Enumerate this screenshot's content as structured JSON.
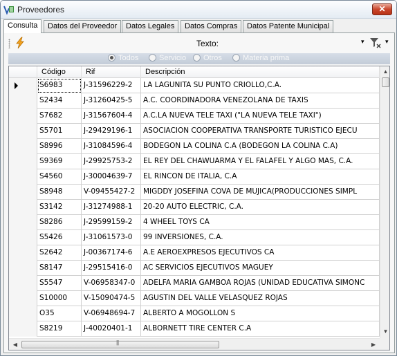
{
  "window": {
    "title": "Proveedores",
    "close_label": "✕"
  },
  "tabs": [
    {
      "label": "Consulta"
    },
    {
      "label": "Datos del Proveedor"
    },
    {
      "label": "Datos Legales"
    },
    {
      "label": "Datos Compras"
    },
    {
      "label": "Datos Patente Municipal"
    }
  ],
  "toolbar": {
    "texto_label": "Texto:",
    "dropdown_glyph": "▾",
    "filter_dropdown_glyph": "▾"
  },
  "filter_options": [
    {
      "label": "Todos",
      "checked": true
    },
    {
      "label": "Servicio",
      "checked": false
    },
    {
      "label": "Otros",
      "checked": false
    },
    {
      "label": "Materia prima",
      "checked": false
    }
  ],
  "grid": {
    "columns": [
      "Código",
      "Rif",
      "Descripción"
    ],
    "rows": [
      [
        "S6983",
        "J-31596229-2",
        " LA LAGUNITA SU PUNTO CRIOLLO,C.A."
      ],
      [
        "S2434",
        "J-31260425-5",
        " A.C. COORDINADORA VENEZOLANA DE TAXIS"
      ],
      [
        "S7682",
        "J-31567604-4",
        " A.C.LA NUEVA TELE TAXI (\"LA NUEVA TELE TAXI\")"
      ],
      [
        "S5701",
        "J-29429196-1",
        " ASOCIACION COOPERATIVA TRANSPORTE TURISTICO EJECU"
      ],
      [
        "S8996",
        "J-31084596-4",
        " BODEGON LA COLINA C.A (BODEGON LA COLINA C.A)"
      ],
      [
        "S9369",
        "J-29925753-2",
        " EL REY DEL CHAWUARMA Y EL FALAFEL Y ALGO MAS, C.A."
      ],
      [
        "S4560",
        "J-30004639-7",
        " EL RINCON DE ITALIA, C.A"
      ],
      [
        "S8948",
        "V-09455427-2",
        " MIGDDY JOSEFINA COVA DE MUJICA(PRODUCCIONES SIMPL"
      ],
      [
        "S3142",
        "J-31274988-1",
        "20-20 AUTO ELECTRIC, C.A."
      ],
      [
        "S8286",
        "J-29599159-2",
        "4 WHEEL TOYS CA"
      ],
      [
        "S5426",
        "J-31061573-0",
        "99 INVERSIONES, C.A."
      ],
      [
        "S2642",
        "J-00367174-6",
        "A.E AEROEXPRESOS EJECUTIVOS CA"
      ],
      [
        "S8147",
        "J-29515416-0",
        "AC SERVICIOS EJECUTIVOS MAGUEY"
      ],
      [
        "S5547",
        "V-06958347-0",
        "ADELFA MARIA GAMBOA ROJAS (UNIDAD EDUCATIVA SIMONC"
      ],
      [
        "S10000",
        "V-15090474-5",
        "AGUSTIN DEL VALLE VELASQUEZ ROJAS"
      ],
      [
        "O35",
        "V-06948694-7",
        "ALBERTO A MOGOLLON S"
      ],
      [
        "S8219",
        "J-40020401-1",
        "ALBORNETT TIRE CENTER C.A"
      ]
    ],
    "selected_row": 0
  },
  "scrollbars": {
    "up": "▲",
    "down": "▼",
    "left": "◀",
    "right": "▶"
  },
  "colors": {
    "close_button": "#c9462c",
    "radio_bar": "#c3ccd8",
    "bolt": "#f2a11f"
  }
}
